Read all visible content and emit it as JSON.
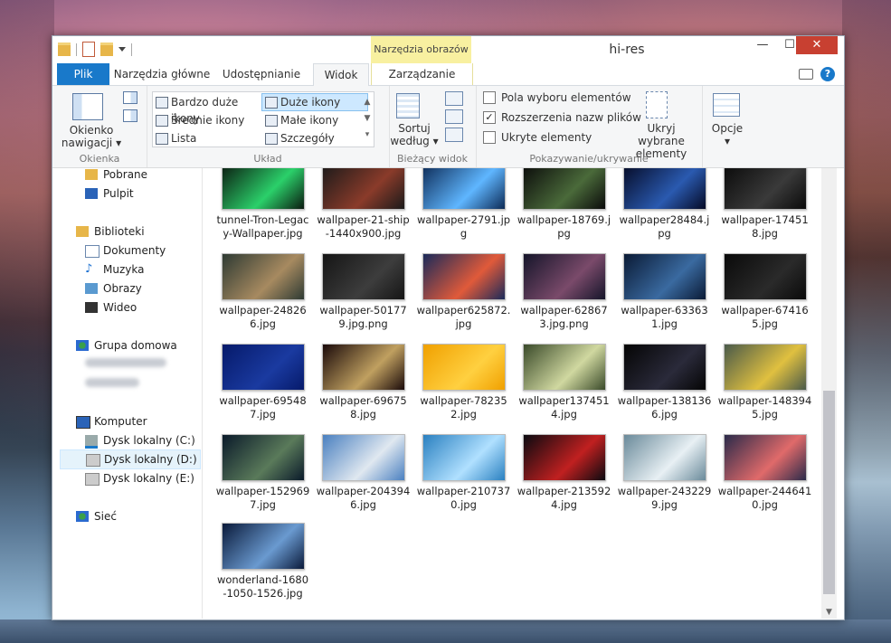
{
  "window": {
    "title": "hi-res",
    "contextual_tab_group": "Narzędzia obrazów",
    "minimize": "—",
    "maximize": "☐",
    "close": "✕"
  },
  "tabs": {
    "file": "Plik",
    "home": "Narzędzia główne",
    "share": "Udostępnianie",
    "view": "Widok",
    "manage": "Zarządzanie"
  },
  "ribbon": {
    "okienka": {
      "label": "Okienka",
      "nav_pane": "Okienko nawigacji"
    },
    "uklad": {
      "label": "Układ",
      "items": [
        {
          "label": "Bardzo duże ikony"
        },
        {
          "label": "Duże ikony"
        },
        {
          "label": "Średnie ikony"
        },
        {
          "label": "Małe ikony"
        },
        {
          "label": "Lista"
        },
        {
          "label": "Szczegóły"
        }
      ]
    },
    "widok": {
      "label": "Bieżący widok",
      "sort": "Sortuj według"
    },
    "pokaz": {
      "label": "Pokazywanie/ukrywanie",
      "checks": [
        {
          "label": "Pola wyboru elementów",
          "checked": false
        },
        {
          "label": "Rozszerzenia nazw plików",
          "checked": true
        },
        {
          "label": "Ukryte elementy",
          "checked": false
        }
      ],
      "hide_selected": "Ukryj wybrane elementy"
    },
    "opcje": {
      "label": "Opcje"
    }
  },
  "nav": {
    "downloads": "Pobrane",
    "desktop": "Pulpit",
    "libraries": "Biblioteki",
    "documents": "Dokumenty",
    "music": "Muzyka",
    "pictures": "Obrazy",
    "video": "Wideo",
    "homegroup": "Grupa domowa",
    "computer": "Komputer",
    "drive_c": "Dysk lokalny (C:)",
    "drive_d": "Dysk lokalny (D:)",
    "drive_e": "Dysk lokalny (E:)",
    "network": "Sieć"
  },
  "files": [
    {
      "name": "tunnel-Tron-Legacy-Wallpaper.jpg",
      "colors": [
        "#0b1a10",
        "#2bd06a"
      ]
    },
    {
      "name": "wallpaper-21-ship-1440x900.jpg",
      "colors": [
        "#1a1a1a",
        "#8a3b2a"
      ]
    },
    {
      "name": "wallpaper-2791.jpg",
      "colors": [
        "#0c2a55",
        "#5fb6ff"
      ]
    },
    {
      "name": "wallpaper-18769.jpg",
      "colors": [
        "#0a0a0a",
        "#4a6a3a"
      ]
    },
    {
      "name": "wallpaper28484.jpg",
      "colors": [
        "#050a25",
        "#2a5ab0"
      ]
    },
    {
      "name": "wallpaper-174518.jpg",
      "colors": [
        "#0a0a0a",
        "#3a3a3a"
      ]
    },
    {
      "name": "wallpaper-248266.jpg",
      "colors": [
        "#2e3a33",
        "#a78a60"
      ]
    },
    {
      "name": "wallpaper-501779.jpg.png",
      "colors": [
        "#151515",
        "#3d3d3d"
      ]
    },
    {
      "name": "wallpaper625872.jpg",
      "colors": [
        "#1a2a5a",
        "#e05a3a"
      ]
    },
    {
      "name": "wallpaper-628673.jpg.png",
      "colors": [
        "#15152a",
        "#7a4a6a"
      ]
    },
    {
      "name": "wallpaper-633631.jpg",
      "colors": [
        "#0a1a35",
        "#3a6aa0"
      ]
    },
    {
      "name": "wallpaper-674165.jpg",
      "colors": [
        "#0a0a0a",
        "#2a2a2a"
      ]
    },
    {
      "name": "wallpaper-695487.jpg",
      "colors": [
        "#061a6a",
        "#1a3aa0"
      ]
    },
    {
      "name": "wallpaper-696758.jpg",
      "colors": [
        "#1a0a0a",
        "#c0a060"
      ]
    },
    {
      "name": "wallpaper-782352.jpg",
      "colors": [
        "#f0a000",
        "#ffd040"
      ]
    },
    {
      "name": "wallpaper1374514.jpg",
      "colors": [
        "#3a4a2a",
        "#d0d8a0"
      ]
    },
    {
      "name": "wallpaper-1381366.jpg",
      "colors": [
        "#050505",
        "#2a2a3a"
      ]
    },
    {
      "name": "wallpaper-1483945.jpg",
      "colors": [
        "#4a5a4a",
        "#e0c040"
      ]
    },
    {
      "name": "wallpaper-1529697.jpg",
      "colors": [
        "#0a1a2a",
        "#5a7a5a"
      ]
    },
    {
      "name": "wallpaper-2043946.jpg",
      "colors": [
        "#4a80c0",
        "#e0e8f0"
      ]
    },
    {
      "name": "wallpaper-2107370.jpg",
      "colors": [
        "#2a80c0",
        "#b0e0ff"
      ]
    },
    {
      "name": "wallpaper-2135924.jpg",
      "colors": [
        "#0a0a10",
        "#c02020"
      ]
    },
    {
      "name": "wallpaper-2432299.jpg",
      "colors": [
        "#6a8a9a",
        "#e8f0f4"
      ]
    },
    {
      "name": "wallpaper-2446410.jpg",
      "colors": [
        "#2a2a4a",
        "#e06a6a"
      ]
    },
    {
      "name": "wonderland-1680-1050-1526.jpg",
      "colors": [
        "#0a1a3a",
        "#6a9ad0"
      ]
    }
  ]
}
